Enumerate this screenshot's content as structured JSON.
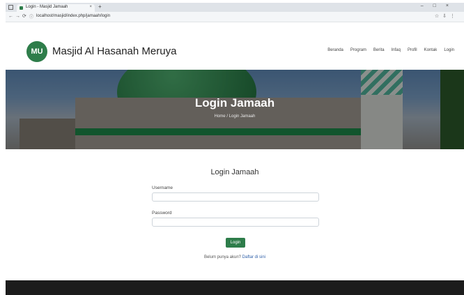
{
  "browser": {
    "tab_title": "Login - Masjid Jamaah",
    "tab_close": "×",
    "new_tab": "+",
    "window_controls": "–□×",
    "nav_icons": "←→⟳",
    "url": "localhost/masjid/index.php/jamaah/login",
    "tool_icons": "☆⇩⋮"
  },
  "site": {
    "logo_text": "MU",
    "name": "Masjid Al Hasanah Meruya",
    "menu": [
      "Beranda",
      "Program",
      "Berita",
      "Infaq",
      "Profil",
      "Kontak",
      "Login"
    ]
  },
  "hero": {
    "title": "Login Jamaah",
    "breadcrumb": "Home / Login Jamaah"
  },
  "form": {
    "title": "Login Jamaah",
    "username_label": "Username",
    "password_label": "Password",
    "submit_label": "Login",
    "signup_text": "Belum punya akun? ",
    "signup_link": "Daftar di sini"
  },
  "colors": {
    "brand_green": "#2e7d4a",
    "footer": "#1c1c1c"
  }
}
